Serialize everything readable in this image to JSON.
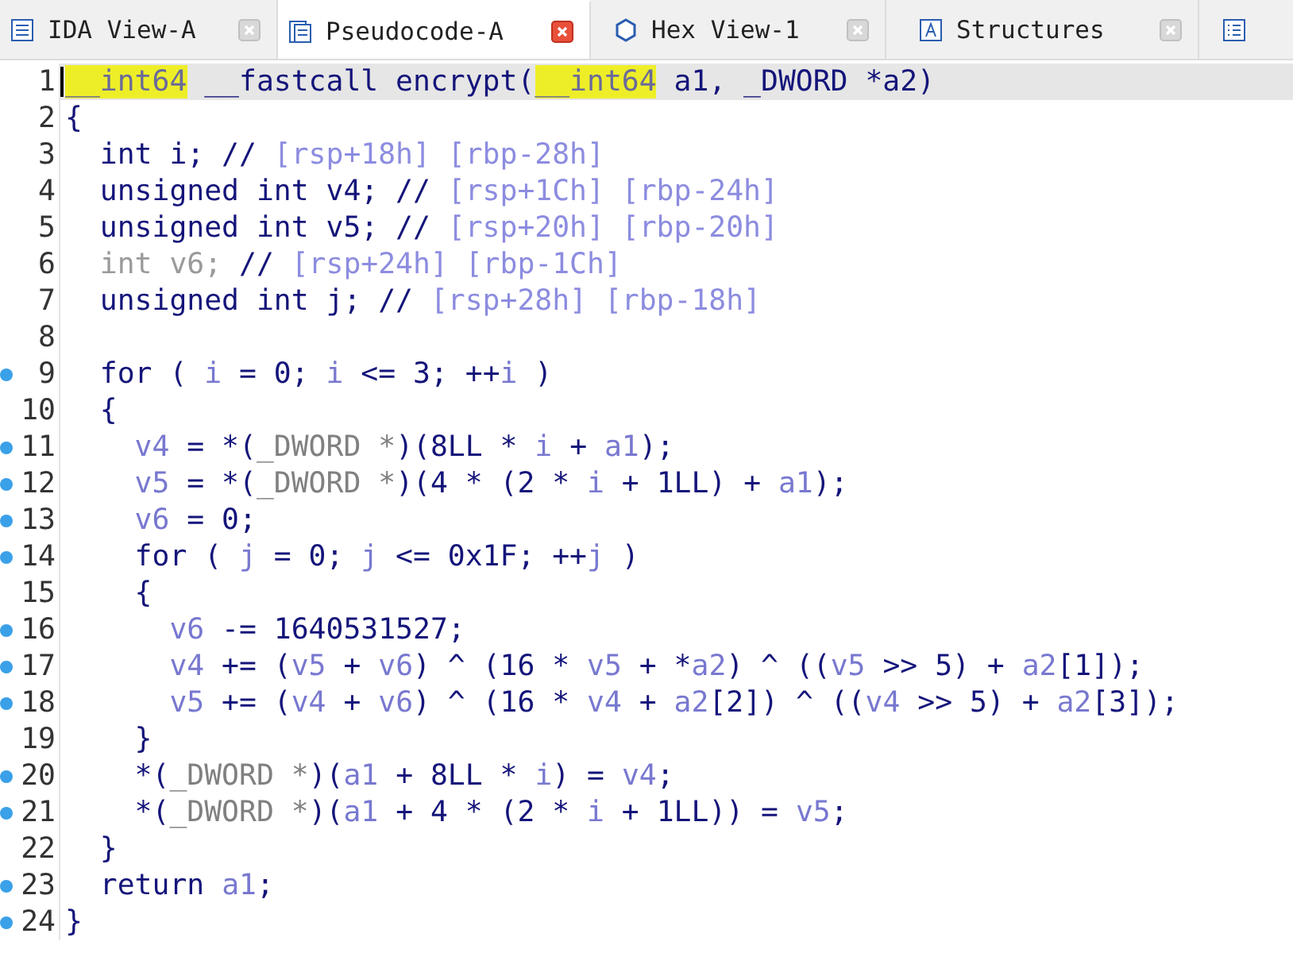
{
  "tabs": [
    {
      "label": "IDA View-A",
      "selected": false
    },
    {
      "label": "Pseudocode-A",
      "selected": true
    },
    {
      "label": "Hex View-1",
      "selected": false
    },
    {
      "label": "Structures",
      "selected": false
    },
    {
      "selected": false
    }
  ],
  "lines": [
    {
      "number": "1",
      "breakpoint": false,
      "current": true,
      "tokens": [
        {
          "kind": "h",
          "text": "__int64"
        },
        {
          "kind": "k",
          "text": " __fastcall encrypt("
        },
        {
          "kind": "h",
          "text": "__int64"
        },
        {
          "kind": "k",
          "text": " a1, _DWORD *a2)"
        }
      ]
    },
    {
      "number": "2",
      "breakpoint": false,
      "current": false,
      "tokens": [
        {
          "kind": "k",
          "text": "{"
        }
      ]
    },
    {
      "number": "3",
      "breakpoint": false,
      "current": false,
      "tokens": [
        {
          "kind": "k",
          "text": "  int i; // "
        },
        {
          "kind": "c",
          "text": "[rsp+18h] [rbp-28h]"
        }
      ]
    },
    {
      "number": "4",
      "breakpoint": false,
      "current": false,
      "tokens": [
        {
          "kind": "k",
          "text": "  unsigned int v4; // "
        },
        {
          "kind": "c",
          "text": "[rsp+1Ch] [rbp-24h]"
        }
      ]
    },
    {
      "number": "5",
      "breakpoint": false,
      "current": false,
      "tokens": [
        {
          "kind": "k",
          "text": "  unsigned int v5; // "
        },
        {
          "kind": "c",
          "text": "[rsp+20h] [rbp-20h]"
        }
      ]
    },
    {
      "number": "6",
      "breakpoint": false,
      "current": false,
      "tokens": [
        {
          "kind": "d",
          "text": "  int v6; "
        },
        {
          "kind": "k",
          "text": "// "
        },
        {
          "kind": "c",
          "text": "[rsp+24h] [rbp-1Ch]"
        }
      ]
    },
    {
      "number": "7",
      "breakpoint": false,
      "current": false,
      "tokens": [
        {
          "kind": "k",
          "text": "  unsigned int j; // "
        },
        {
          "kind": "c",
          "text": "[rsp+28h] [rbp-18h]"
        }
      ]
    },
    {
      "number": "8",
      "breakpoint": false,
      "current": false
    },
    {
      "number": "9",
      "breakpoint": true,
      "current": false,
      "tokens": [
        {
          "kind": "k",
          "text": "  for ( "
        },
        {
          "kind": "v",
          "text": "i"
        },
        {
          "kind": "k",
          "text": " = 0; "
        },
        {
          "kind": "v",
          "text": "i"
        },
        {
          "kind": "k",
          "text": " <= 3; ++"
        },
        {
          "kind": "v",
          "text": "i"
        },
        {
          "kind": "k",
          "text": " )"
        }
      ]
    },
    {
      "number": "10",
      "breakpoint": false,
      "current": false,
      "tokens": [
        {
          "kind": "k",
          "text": "  {"
        }
      ]
    },
    {
      "number": "11",
      "breakpoint": true,
      "current": false,
      "tokens": [
        {
          "kind": "v",
          "text": "    v4"
        },
        {
          "kind": "k",
          "text": " = *("
        },
        {
          "kind": "g",
          "text": "_DWORD *"
        },
        {
          "kind": "k",
          "text": ")(8LL * "
        },
        {
          "kind": "v",
          "text": "i"
        },
        {
          "kind": "k",
          "text": " + "
        },
        {
          "kind": "v",
          "text": "a1"
        },
        {
          "kind": "k",
          "text": ");"
        }
      ]
    },
    {
      "number": "12",
      "breakpoint": true,
      "current": false,
      "tokens": [
        {
          "kind": "v",
          "text": "    v5"
        },
        {
          "kind": "k",
          "text": " = *("
        },
        {
          "kind": "g",
          "text": "_DWORD *"
        },
        {
          "kind": "k",
          "text": ")(4 * (2 * "
        },
        {
          "kind": "v",
          "text": "i"
        },
        {
          "kind": "k",
          "text": " + 1LL) + "
        },
        {
          "kind": "v",
          "text": "a1"
        },
        {
          "kind": "k",
          "text": ");"
        }
      ]
    },
    {
      "number": "13",
      "breakpoint": true,
      "current": false,
      "tokens": [
        {
          "kind": "v",
          "text": "    v6"
        },
        {
          "kind": "k",
          "text": " = 0;"
        }
      ]
    },
    {
      "number": "14",
      "breakpoint": true,
      "current": false,
      "tokens": [
        {
          "kind": "k",
          "text": "    for ( "
        },
        {
          "kind": "v",
          "text": "j"
        },
        {
          "kind": "k",
          "text": " = 0; "
        },
        {
          "kind": "v",
          "text": "j"
        },
        {
          "kind": "k",
          "text": " <= 0x1F; ++"
        },
        {
          "kind": "v",
          "text": "j"
        },
        {
          "kind": "k",
          "text": " )"
        }
      ]
    },
    {
      "number": "15",
      "breakpoint": false,
      "current": false,
      "tokens": [
        {
          "kind": "k",
          "text": "    {"
        }
      ]
    },
    {
      "number": "16",
      "breakpoint": true,
      "current": false,
      "tokens": [
        {
          "kind": "v",
          "text": "      v6"
        },
        {
          "kind": "k",
          "text": " -= 1640531527;"
        }
      ]
    },
    {
      "number": "17",
      "breakpoint": true,
      "current": false,
      "tokens": [
        {
          "kind": "v",
          "text": "      v4"
        },
        {
          "kind": "k",
          "text": " += ("
        },
        {
          "kind": "v",
          "text": "v5"
        },
        {
          "kind": "k",
          "text": " + "
        },
        {
          "kind": "v",
          "text": "v6"
        },
        {
          "kind": "k",
          "text": ") ^ (16 * "
        },
        {
          "kind": "v",
          "text": "v5"
        },
        {
          "kind": "k",
          "text": " + *"
        },
        {
          "kind": "v",
          "text": "a2"
        },
        {
          "kind": "k",
          "text": ") ^ (("
        },
        {
          "kind": "v",
          "text": "v5"
        },
        {
          "kind": "k",
          "text": " >> 5) + "
        },
        {
          "kind": "v",
          "text": "a2"
        },
        {
          "kind": "k",
          "text": "[1]);"
        }
      ]
    },
    {
      "number": "18",
      "breakpoint": true,
      "current": false,
      "tokens": [
        {
          "kind": "v",
          "text": "      v5"
        },
        {
          "kind": "k",
          "text": " += ("
        },
        {
          "kind": "v",
          "text": "v4"
        },
        {
          "kind": "k",
          "text": " + "
        },
        {
          "kind": "v",
          "text": "v6"
        },
        {
          "kind": "k",
          "text": ") ^ (16 * "
        },
        {
          "kind": "v",
          "text": "v4"
        },
        {
          "kind": "k",
          "text": " + "
        },
        {
          "kind": "v",
          "text": "a2"
        },
        {
          "kind": "k",
          "text": "[2]) ^ (("
        },
        {
          "kind": "v",
          "text": "v4"
        },
        {
          "kind": "k",
          "text": " >> 5) + "
        },
        {
          "kind": "v",
          "text": "a2"
        },
        {
          "kind": "k",
          "text": "[3]);"
        }
      ]
    },
    {
      "number": "19",
      "breakpoint": false,
      "current": false,
      "tokens": [
        {
          "kind": "k",
          "text": "    }"
        }
      ]
    },
    {
      "number": "20",
      "breakpoint": true,
      "current": false,
      "tokens": [
        {
          "kind": "k",
          "text": "    *("
        },
        {
          "kind": "g",
          "text": "_DWORD *"
        },
        {
          "kind": "k",
          "text": ")("
        },
        {
          "kind": "v",
          "text": "a1"
        },
        {
          "kind": "k",
          "text": " + 8LL * "
        },
        {
          "kind": "v",
          "text": "i"
        },
        {
          "kind": "k",
          "text": ") = "
        },
        {
          "kind": "v",
          "text": "v4"
        },
        {
          "kind": "k",
          "text": ";"
        }
      ]
    },
    {
      "number": "21",
      "breakpoint": true,
      "current": false,
      "tokens": [
        {
          "kind": "k",
          "text": "    *("
        },
        {
          "kind": "g",
          "text": "_DWORD *"
        },
        {
          "kind": "k",
          "text": ")("
        },
        {
          "kind": "v",
          "text": "a1"
        },
        {
          "kind": "k",
          "text": " + 4 * (2 * "
        },
        {
          "kind": "v",
          "text": "i"
        },
        {
          "kind": "k",
          "text": " + 1LL)) = "
        },
        {
          "kind": "v",
          "text": "v5"
        },
        {
          "kind": "k",
          "text": ";"
        }
      ]
    },
    {
      "number": "22",
      "breakpoint": false,
      "current": false,
      "tokens": [
        {
          "kind": "k",
          "text": "  }"
        }
      ]
    },
    {
      "number": "23",
      "breakpoint": true,
      "current": false,
      "tokens": [
        {
          "kind": "k",
          "text": "  return "
        },
        {
          "kind": "v",
          "text": "a1"
        },
        {
          "kind": "k",
          "text": ";"
        }
      ]
    },
    {
      "number": "24",
      "breakpoint": true,
      "current": false,
      "tokens": [
        {
          "kind": "k",
          "text": "}"
        }
      ]
    }
  ]
}
